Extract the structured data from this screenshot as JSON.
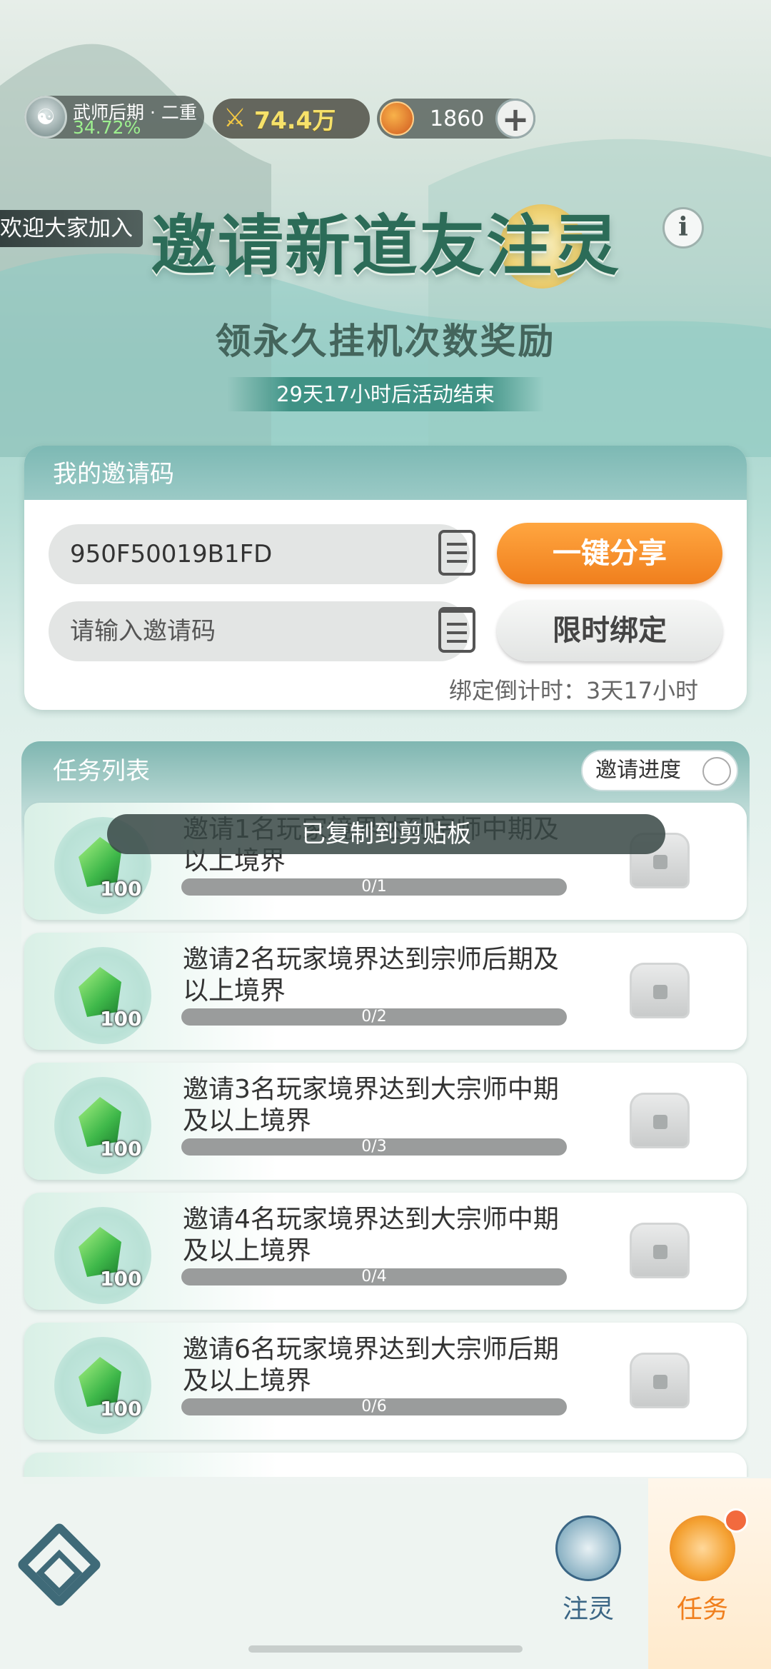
{
  "status_bar": {
    "realm_label": "武师后期 · 二重",
    "realm_percent": "34.72%",
    "power_value": "74.4万",
    "currency_value": "1860"
  },
  "banner": {
    "welcome_text": "欢迎大家加入",
    "title": "邀请新道友注灵",
    "subtitle": "领永久挂机次数奖励",
    "timer_text": "29天17小时后活动结束"
  },
  "invite_card": {
    "header": "我的邀请码",
    "my_code": "950F50019B1FD",
    "share_button": "一键分享",
    "input_placeholder": "请输入邀请码",
    "bind_button": "限时绑定",
    "bind_countdown": "绑定倒计时：3天17小时"
  },
  "task_list": {
    "header": "任务列表",
    "progress_button": "邀请进度",
    "toast": "已复制到剪贴板",
    "items": [
      {
        "desc": "邀请1名玩家境界达到宗师中期及以上境界",
        "progress_text": "0/1",
        "progress": 0,
        "reward_count": "100"
      },
      {
        "desc": "邀请2名玩家境界达到宗师后期及以上境界",
        "progress_text": "0/2",
        "progress": 0,
        "reward_count": "100"
      },
      {
        "desc": "邀请3名玩家境界达到大宗师中期及以上境界",
        "progress_text": "0/3",
        "progress": 0,
        "reward_count": "100"
      },
      {
        "desc": "邀请4名玩家境界达到大宗师中期及以上境界",
        "progress_text": "0/4",
        "progress": 0,
        "reward_count": "100"
      },
      {
        "desc": "邀请6名玩家境界达到大宗师后期及以上境界",
        "progress_text": "0/6",
        "progress": 0,
        "reward_count": "100"
      }
    ]
  },
  "bottom_nav": {
    "items": [
      {
        "label": "注灵",
        "icon": "leaf-spirit-icon",
        "active": false
      },
      {
        "label": "任务",
        "icon": "scroll-ribbon-icon",
        "active": true
      }
    ]
  },
  "colors": {
    "accent_orange": "#f07f1d",
    "teal_header": "#7db9b4",
    "title_green": "#2c6c58"
  }
}
